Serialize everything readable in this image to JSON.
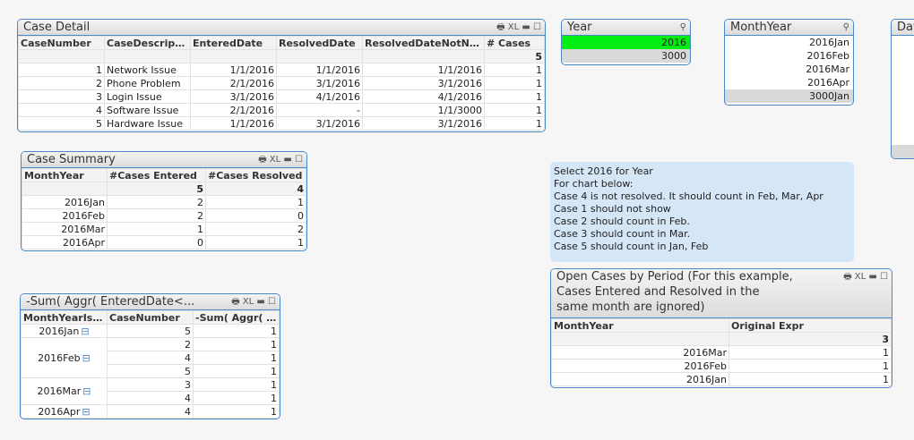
{
  "case_detail": {
    "title": "Case Detail",
    "columns": [
      "CaseNumber",
      "CaseDescription",
      "EnteredDate",
      "ResolvedDate",
      "ResolvedDateNotNull",
      "# Cases"
    ],
    "total": [
      "",
      "",
      "",
      "",
      "",
      "5"
    ],
    "rows": [
      [
        "1",
        "Network Issue",
        "1/1/2016",
        "1/1/2016",
        "1/1/2016",
        "1"
      ],
      [
        "2",
        "Phone Problem",
        "2/1/2016",
        "3/1/2016",
        "3/1/2016",
        "1"
      ],
      [
        "3",
        "Login Issue",
        "3/1/2016",
        "4/1/2016",
        "4/1/2016",
        "1"
      ],
      [
        "4",
        "Software Issue",
        "2/1/2016",
        "-",
        "1/1/3000",
        "1"
      ],
      [
        "5",
        "Hardware Issue",
        "1/1/2016",
        "3/1/2016",
        "3/1/2016",
        "1"
      ]
    ]
  },
  "year": {
    "title": "Year",
    "items": [
      "2016",
      "3000"
    ],
    "selected_color": "#00ee11"
  },
  "monthyear": {
    "title": "MonthYear",
    "items": [
      "2016Jan",
      "2016Feb",
      "2016Mar",
      "2016Apr",
      "3000Jan"
    ]
  },
  "dat": {
    "title": "Dat"
  },
  "case_summary": {
    "title": "Case Summary",
    "columns": [
      "MonthYear",
      "#Cases Entered",
      "#Cases Resolved"
    ],
    "total": [
      "",
      "5",
      "4"
    ],
    "rows": [
      [
        "2016Jan",
        "2",
        "1"
      ],
      [
        "2016Feb",
        "2",
        "0"
      ],
      [
        "2016Mar",
        "1",
        "2"
      ],
      [
        "2016Apr",
        "0",
        "1"
      ]
    ]
  },
  "note": [
    "Select 2016 for Year",
    "For chart below:",
    "Case 4 is not resolved.  It should count in Feb, Mar, Apr",
    "Case 1 should not show",
    "Case 2 should count  in Feb.",
    "Case 3 should count  in Mar.",
    "Case 5 should count in Jan, Feb"
  ],
  "aggr": {
    "title": "-Sum( Aggr( EnteredDate<...",
    "columns": [
      "MonthYearIsl...",
      "CaseNumber",
      "-Sum( Aggr( En..."
    ],
    "groups": [
      {
        "month": "2016Jan",
        "rows": [
          [
            "5",
            "1"
          ]
        ]
      },
      {
        "month": "2016Feb",
        "rows": [
          [
            "2",
            "1"
          ],
          [
            "4",
            "1"
          ],
          [
            "5",
            "1"
          ]
        ]
      },
      {
        "month": "2016Mar",
        "rows": [
          [
            "3",
            "1"
          ],
          [
            "4",
            "1"
          ]
        ]
      },
      {
        "month": "2016Apr",
        "rows": [
          [
            "4",
            "1"
          ]
        ]
      }
    ]
  },
  "open_cases": {
    "title": "Open Cases by Period (For this example, Cases Entered and Resolved in the same month are ignored)",
    "columns": [
      "MonthYear",
      "Original Expr"
    ],
    "total": [
      "",
      "3"
    ],
    "rows": [
      [
        "2016Mar",
        "1"
      ],
      [
        "2016Feb",
        "1"
      ],
      [
        "2016Jan",
        "1"
      ]
    ]
  },
  "icons": {
    "print": "print-icon",
    "xl": "XL",
    "min": "minimize-icon",
    "max": "maximize-icon"
  }
}
